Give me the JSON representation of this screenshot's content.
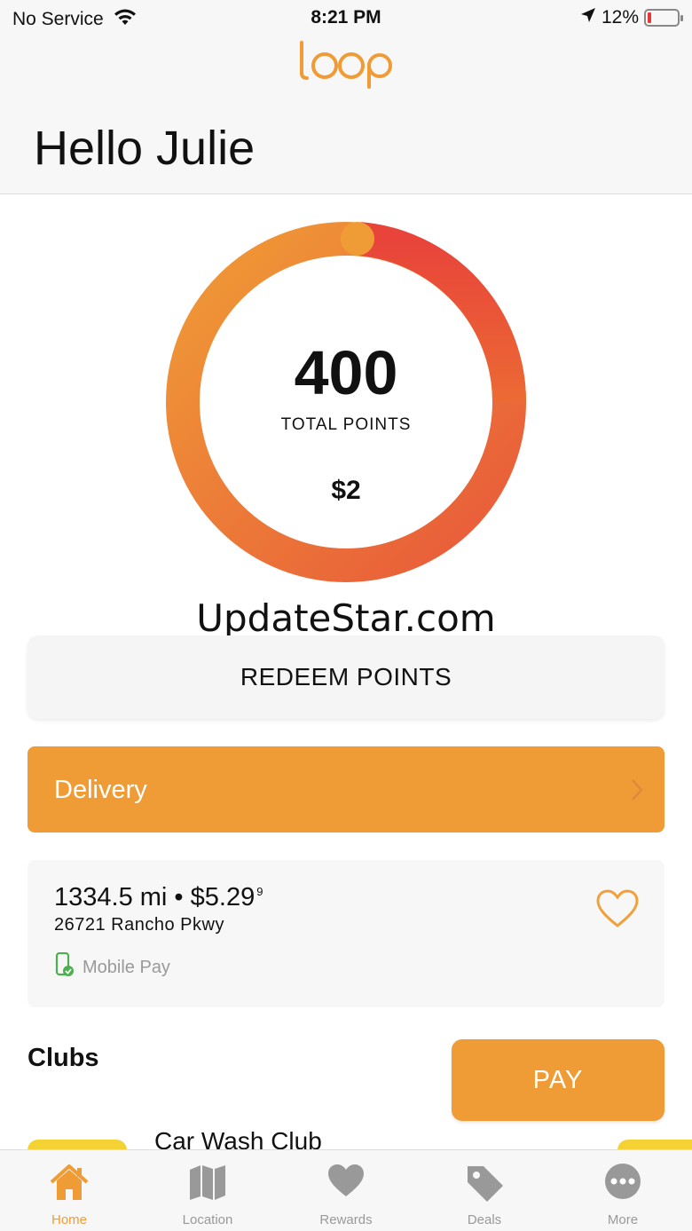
{
  "status_bar": {
    "carrier": "No Service",
    "time": "8:21 PM",
    "battery_percent": "12%",
    "battery_level": 0.12
  },
  "header": {
    "logo_text": "loop",
    "greeting": "Hello Julie"
  },
  "points_summary": {
    "total_points": "400",
    "total_points_label": "TOTAL POINTS",
    "dollar_value": "$2",
    "ring_colors": {
      "start": "#f09c36",
      "end": "#e84a36"
    }
  },
  "watermark": "UpdateStar.com",
  "redeem_button": {
    "label": "REDEEM POINTS"
  },
  "delivery": {
    "label": "Delivery"
  },
  "station": {
    "distance": "1334.5 mi",
    "separator": "•",
    "price": "$5.29",
    "price_fraction": "9",
    "address": "26721 Rancho Pkwy",
    "mobile_pay": "Mobile Pay"
  },
  "clubs": {
    "title": "Clubs",
    "items": [
      {
        "name": "Car Wash Club"
      }
    ]
  },
  "pay_button": {
    "label": "PAY"
  },
  "tab_bar": {
    "tabs": [
      {
        "label": "Home",
        "icon": "home-icon",
        "active": true
      },
      {
        "label": "Location",
        "icon": "map-icon",
        "active": false
      },
      {
        "label": "Rewards",
        "icon": "heart-icon",
        "active": false
      },
      {
        "label": "Deals",
        "icon": "tag-icon",
        "active": false
      },
      {
        "label": "More",
        "icon": "more-icon",
        "active": false
      }
    ]
  },
  "colors": {
    "accent": "#f09c36",
    "club_tab": "#f4d234",
    "mobile_pay_icon": "#4caf50",
    "inactive_tab": "#999999"
  }
}
